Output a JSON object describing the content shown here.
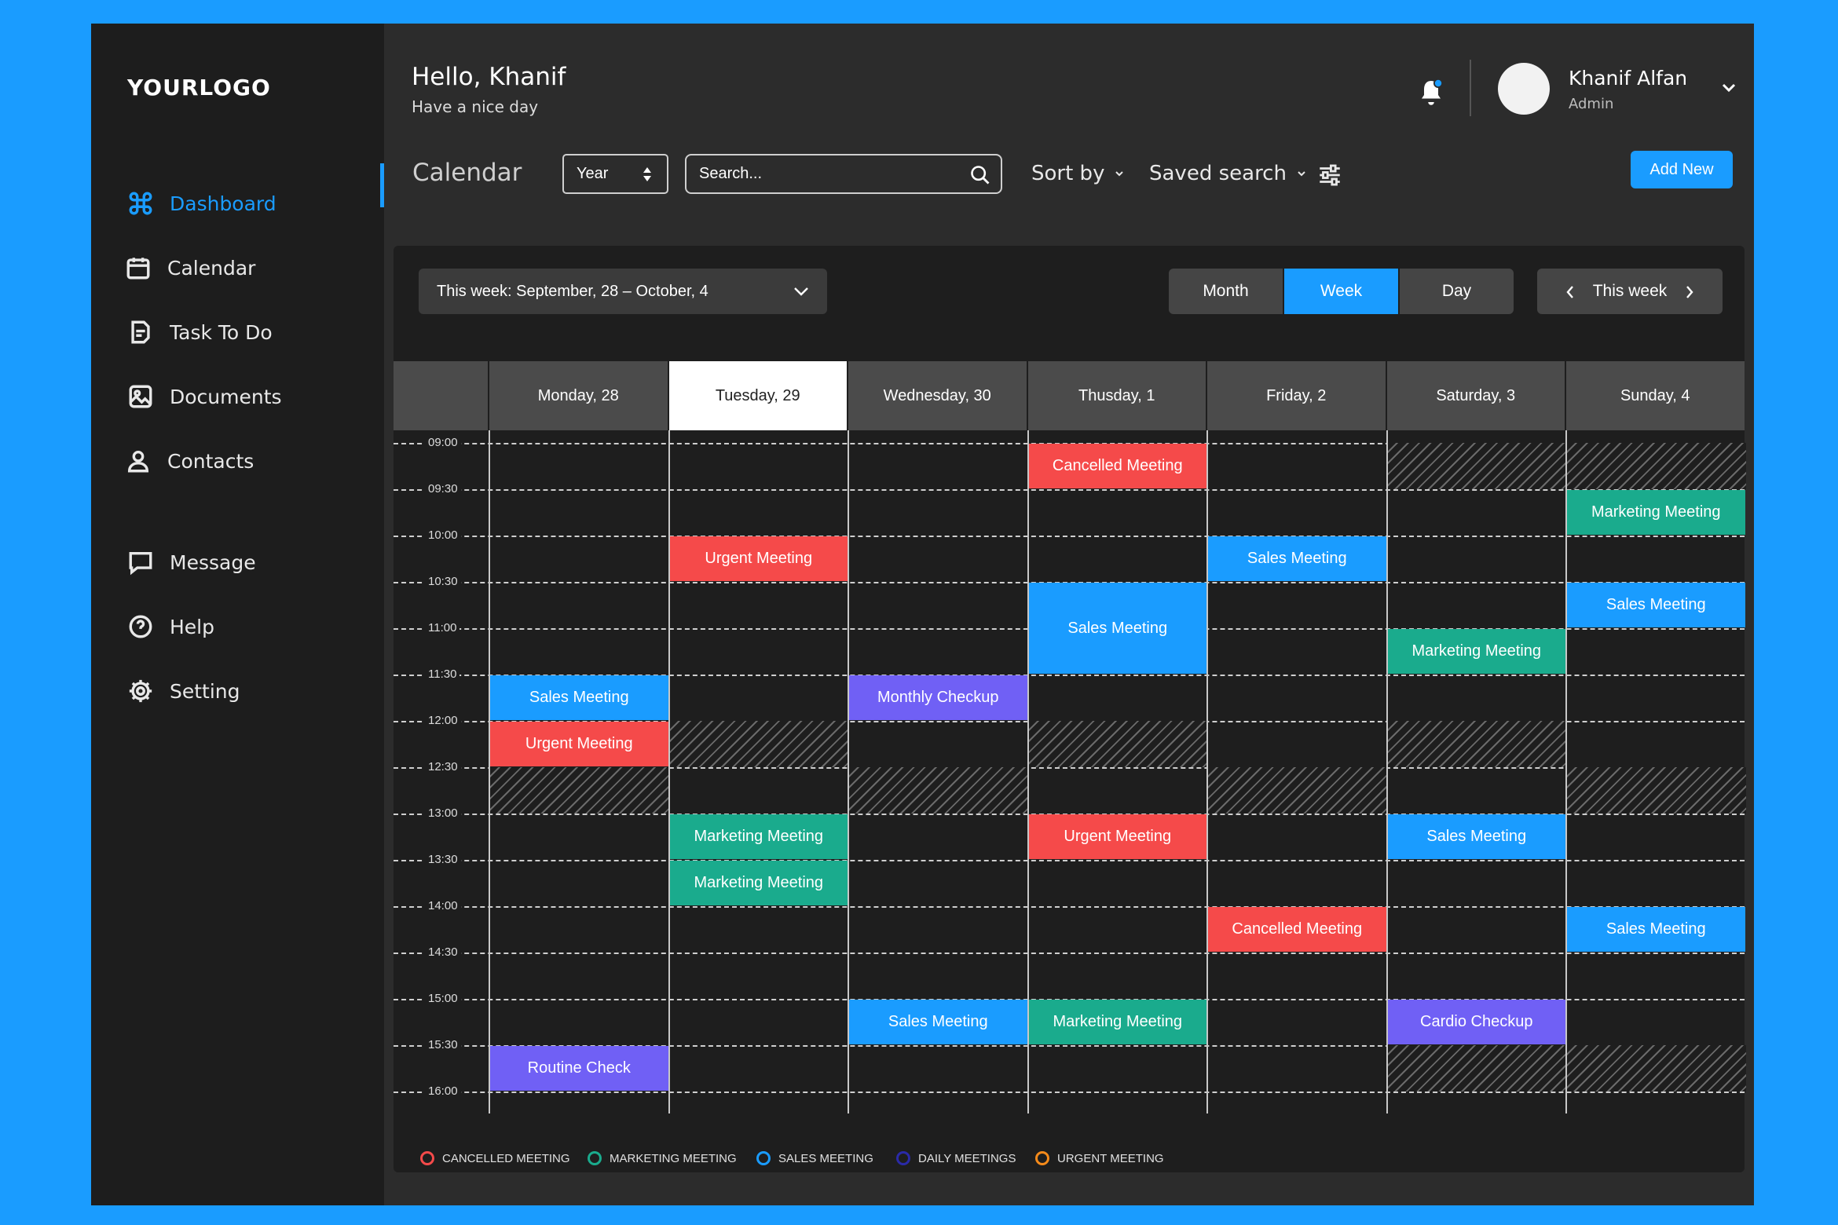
{
  "sidebar": {
    "logo": "YOURLOGO",
    "items": [
      {
        "label": "Dashboard",
        "icon": "command-icon"
      },
      {
        "label": "Calendar",
        "icon": "calendar-icon"
      },
      {
        "label": "Task To Do",
        "icon": "task-icon"
      },
      {
        "label": "Documents",
        "icon": "image-icon"
      },
      {
        "label": "Contacts",
        "icon": "user-icon"
      },
      {
        "label": "Message",
        "icon": "message-icon"
      },
      {
        "label": "Help",
        "icon": "help-icon"
      },
      {
        "label": "Setting",
        "icon": "gear-icon"
      }
    ],
    "active_index": 0
  },
  "header": {
    "greeting": "Hello, Khanif",
    "subtitle": "Have a nice day",
    "user_name": "Khanif Alfan",
    "user_role": "Admin"
  },
  "toolbar": {
    "title": "Calendar",
    "range_select": "Year",
    "search_placeholder": "Search...",
    "sort_label": "Sort by",
    "saved_search_label": "Saved search",
    "add_new_label": "Add New"
  },
  "calendar": {
    "week_range_prefix": "This week:",
    "week_range": "September, 28 – October, 4",
    "view_options": [
      "Month",
      "Week",
      "Day"
    ],
    "selected_view": "Week",
    "nav_label": "This week",
    "days": [
      "Monday, 28",
      "Tuesday, 29",
      "Wednesday, 30",
      "Thusday, 1",
      "Friday, 2",
      "Saturday, 3",
      "Sunday, 4"
    ],
    "today_index": 1,
    "times": [
      "09:00",
      "09:30",
      "10:00",
      "10:30",
      "11:00",
      "11:30",
      "12:00",
      "12:30",
      "13:00",
      "13:30",
      "14:00",
      "14:30",
      "15:00",
      "15:30",
      "16:00"
    ],
    "colors": {
      "cancelled": "#f54a4a",
      "urgent": "#f54a4a",
      "sales": "#1a9cff",
      "marketing": "#1aab8d",
      "checkup": "#7060f5"
    },
    "events": [
      {
        "day": 0,
        "start": 5,
        "span": 1,
        "title": "Sales Meeting",
        "type": "sales"
      },
      {
        "day": 0,
        "start": 6,
        "span": 1,
        "title": "Urgent Meeting",
        "type": "urgent"
      },
      {
        "day": 0,
        "start": 13,
        "span": 1,
        "title": "Routine Check",
        "type": "checkup"
      },
      {
        "day": 1,
        "start": 2,
        "span": 1,
        "title": "Urgent Meeting",
        "type": "urgent"
      },
      {
        "day": 1,
        "start": 8,
        "span": 1,
        "title": "Marketing Meeting",
        "type": "marketing"
      },
      {
        "day": 1,
        "start": 9,
        "span": 1,
        "title": "Marketing Meeting",
        "type": "marketing"
      },
      {
        "day": 2,
        "start": 5,
        "span": 1,
        "title": "Monthly Checkup",
        "type": "checkup"
      },
      {
        "day": 2,
        "start": 12,
        "span": 1,
        "title": "Sales Meeting",
        "type": "sales"
      },
      {
        "day": 3,
        "start": 0,
        "span": 1,
        "title": "Cancelled Meeting",
        "type": "cancelled"
      },
      {
        "day": 3,
        "start": 3,
        "span": 2,
        "title": "Sales Meeting",
        "type": "sales"
      },
      {
        "day": 3,
        "start": 8,
        "span": 1,
        "title": "Urgent Meeting",
        "type": "urgent"
      },
      {
        "day": 3,
        "start": 12,
        "span": 1,
        "title": "Marketing Meeting",
        "type": "marketing"
      },
      {
        "day": 4,
        "start": 2,
        "span": 1,
        "title": "Sales Meeting",
        "type": "sales"
      },
      {
        "day": 4,
        "start": 10,
        "span": 1,
        "title": "Cancelled Meeting",
        "type": "cancelled"
      },
      {
        "day": 5,
        "start": 4,
        "span": 1,
        "title": "Marketing Meeting",
        "type": "marketing"
      },
      {
        "day": 5,
        "start": 8,
        "span": 1,
        "title": "Sales Meeting",
        "type": "sales"
      },
      {
        "day": 5,
        "start": 12,
        "span": 1,
        "title": "Cardio Checkup",
        "type": "checkup"
      },
      {
        "day": 6,
        "start": 1,
        "span": 1,
        "title": "Marketing Meeting",
        "type": "marketing"
      },
      {
        "day": 6,
        "start": 3,
        "span": 1,
        "title": "Sales Meeting",
        "type": "sales"
      },
      {
        "day": 6,
        "start": 10,
        "span": 1,
        "title": "Sales Meeting",
        "type": "sales"
      }
    ],
    "blocked": [
      {
        "day": 0,
        "start": 7
      },
      {
        "day": 1,
        "start": 6
      },
      {
        "day": 2,
        "start": 7
      },
      {
        "day": 3,
        "start": 6
      },
      {
        "day": 4,
        "start": 7
      },
      {
        "day": 5,
        "start": 0
      },
      {
        "day": 5,
        "start": 6
      },
      {
        "day": 5,
        "start": 13
      },
      {
        "day": 6,
        "start": 0
      },
      {
        "day": 6,
        "start": 7
      },
      {
        "day": 6,
        "start": 13
      }
    ]
  },
  "legend": [
    {
      "label": "CANCELLED MEETING",
      "color": "#f54a4a"
    },
    {
      "label": "MARKETING MEETING",
      "color": "#1aab8d"
    },
    {
      "label": "SALES MEETING",
      "color": "#1a9cff"
    },
    {
      "label": "DAILY MEETINGS",
      "color": "#2a2aa8"
    },
    {
      "label": "URGENT MEETING",
      "color": "#f58a1a"
    }
  ]
}
